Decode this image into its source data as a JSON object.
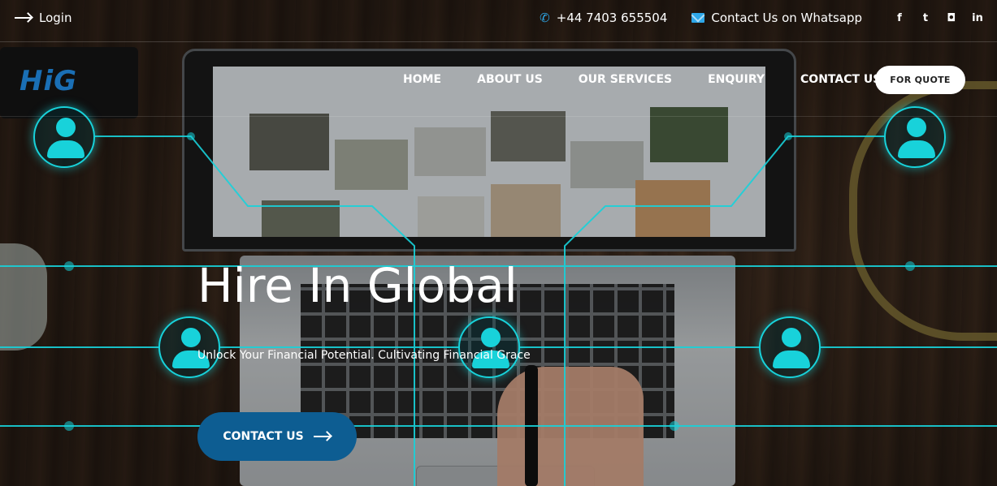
{
  "topbar": {
    "login_label": "Login",
    "phone": "+44 7403 655504",
    "whatsapp": "Contact Us on Whatsapp",
    "social": [
      {
        "icon": "facebook-icon",
        "glyph": "f"
      },
      {
        "icon": "twitter-icon",
        "glyph": "t"
      },
      {
        "icon": "instagram-icon",
        "glyph": "◘"
      },
      {
        "icon": "linkedin-icon",
        "glyph": "in"
      }
    ]
  },
  "nav": {
    "logo": "HiG",
    "items": [
      "HOME",
      "ABOUT US",
      "OUR SERVICES",
      "ENQUIRY",
      "CONTACT US"
    ],
    "quote_button": "FOR QUOTE"
  },
  "hero": {
    "title": "Hire In Global",
    "subtitle": "Unlock Your Financial Potential. Cultivating Financial Grace",
    "cta_label": "CONTACT US"
  },
  "colors": {
    "accent": "#18d2da",
    "brand": "#0d5d92",
    "icon_blue": "#2ea7e8"
  }
}
